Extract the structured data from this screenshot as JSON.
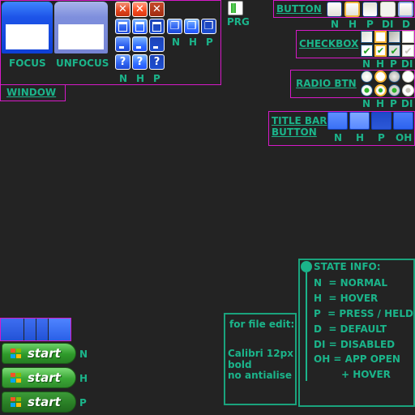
{
  "window": {
    "label": "WINDOW",
    "focus_label": "FOCUS",
    "unfocus_label": "UNFOCUS",
    "caption_states": [
      "N",
      "H",
      "P"
    ],
    "restore_states": [
      "N",
      "H",
      "P"
    ]
  },
  "progress": {
    "label": "PRG"
  },
  "button": {
    "label": "BUTTON",
    "states": [
      "N",
      "H",
      "P",
      "DI",
      "D"
    ]
  },
  "checkbox": {
    "label": "CHECKBOX",
    "states": [
      "N",
      "H",
      "P",
      "DI"
    ]
  },
  "radio": {
    "label": "RADIO BTN",
    "states": [
      "N",
      "H",
      "P",
      "DI"
    ]
  },
  "titlebar": {
    "label_line1": "TITLE BAR",
    "label_line2": "BUTTON",
    "states": [
      "N",
      "H",
      "P",
      "OH"
    ]
  },
  "state_info": {
    "title": "STATE INFO:",
    "lines": [
      "N  = NORMAL",
      "H  = HOVER",
      "P  = PRESS / HELD",
      "D  = DEFAULT",
      "DI = DISABLED",
      "OH = APP OPEN",
      "+ HOVER"
    ]
  },
  "file_edit": {
    "title": "for file edit:",
    "lines": [
      "Calibri 12px",
      "bold",
      "no antialise"
    ]
  },
  "start": {
    "button_text": "start",
    "states": [
      "N",
      "H",
      "P"
    ]
  },
  "colors": {
    "accent": "#1bb48a",
    "border_magenta": "#d619c8",
    "border_teal": "#1aa37d",
    "background": "#232323"
  }
}
